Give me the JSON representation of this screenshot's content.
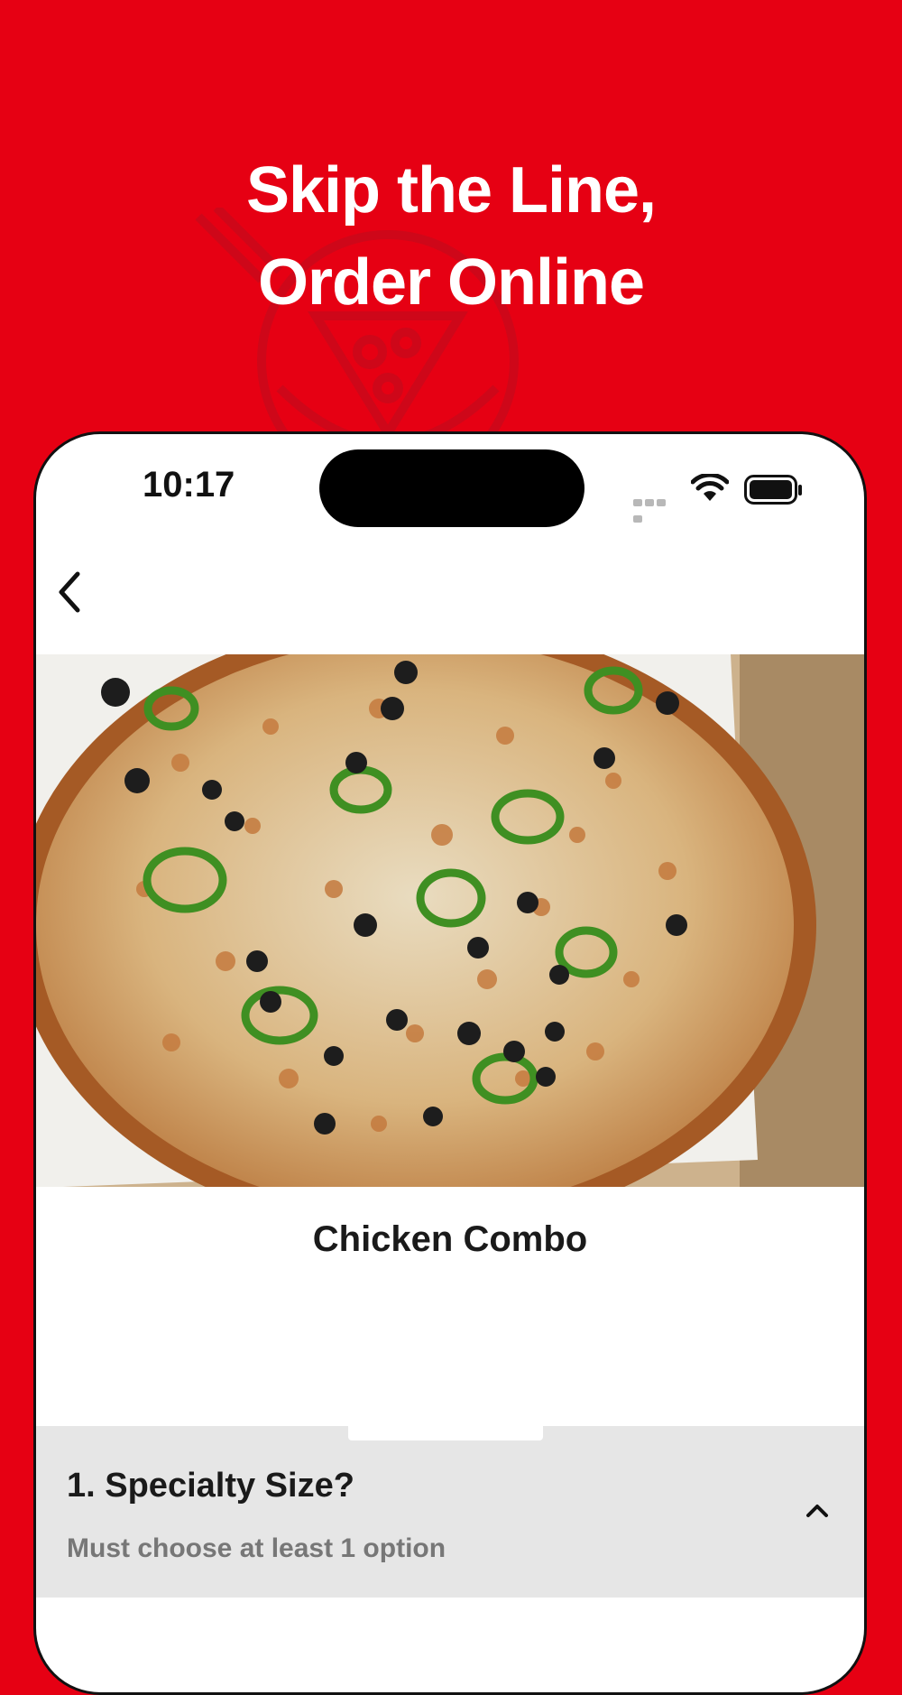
{
  "promo": {
    "headline_line1": "Skip the Line,",
    "headline_line2": "Order Online"
  },
  "status_bar": {
    "time": "10:17",
    "icons": [
      "cellular-signal-icon",
      "wifi-icon",
      "battery-icon"
    ]
  },
  "nav": {
    "back_icon": "chevron-left-icon"
  },
  "item": {
    "name": "Chicken Combo"
  },
  "options": [
    {
      "title": "1. Specialty Size?",
      "subtitle": "Must choose at least 1 option",
      "icon": "chevron-up-icon"
    }
  ],
  "colors": {
    "brand_red": "#e60013",
    "section_bg": "#e6e6e6"
  }
}
